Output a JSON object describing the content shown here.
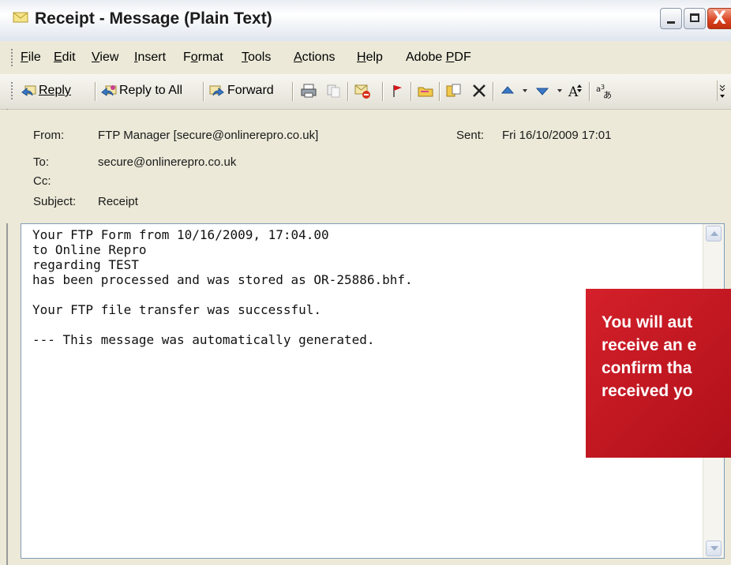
{
  "window": {
    "title": "Receipt - Message (Plain Text)",
    "controls": {
      "minimize": "minimize",
      "maximize": "maximize",
      "close": "X"
    }
  },
  "menubar": {
    "items": [
      {
        "label": "File",
        "key": "F"
      },
      {
        "label": "Edit",
        "key": "E"
      },
      {
        "label": "View",
        "key": "V"
      },
      {
        "label": "Insert",
        "key": "I"
      },
      {
        "label": "Format",
        "key": "o"
      },
      {
        "label": "Tools",
        "key": "T"
      },
      {
        "label": "Actions",
        "key": "A"
      },
      {
        "label": "Help",
        "key": "H"
      },
      {
        "label": "Adobe PDF",
        "key": "P"
      }
    ]
  },
  "toolbar": {
    "reply": "Reply",
    "reply_all": "Reply to All",
    "forward": "Forward",
    "icons": [
      "print-icon",
      "copy-icon",
      "delete-mail-icon",
      "flag-icon",
      "folder-icon",
      "move-icon",
      "delete-x-icon",
      "previous-item-icon",
      "next-item-icon",
      "font-size-icon",
      "encoding-icon"
    ]
  },
  "header": {
    "from_label": "From:",
    "from_value": "FTP Manager [secure@onlinerepro.co.uk]",
    "sent_label": "Sent:",
    "sent_value": "Fri 16/10/2009 17:01",
    "to_label": "To:",
    "to_value": "secure@onlinerepro.co.uk",
    "cc_label": "Cc:",
    "cc_value": "",
    "subject_label": "Subject:",
    "subject_value": "Receipt"
  },
  "body": {
    "text": "Your FTP Form from 10/16/2009, 17:04.00\nto Online Repro\nregarding TEST\nhas been processed and was stored as OR-25886.bhf.\n\nYour FTP file transfer was successful.\n\n--- This message was automatically generated."
  },
  "callout": {
    "lines": [
      "You will aut",
      "receive an e",
      "confirm tha",
      "received yo"
    ]
  },
  "colors": {
    "callout_red": "#c8161e",
    "window_bg": "#ece9d8",
    "close_button": "#d8421f"
  }
}
